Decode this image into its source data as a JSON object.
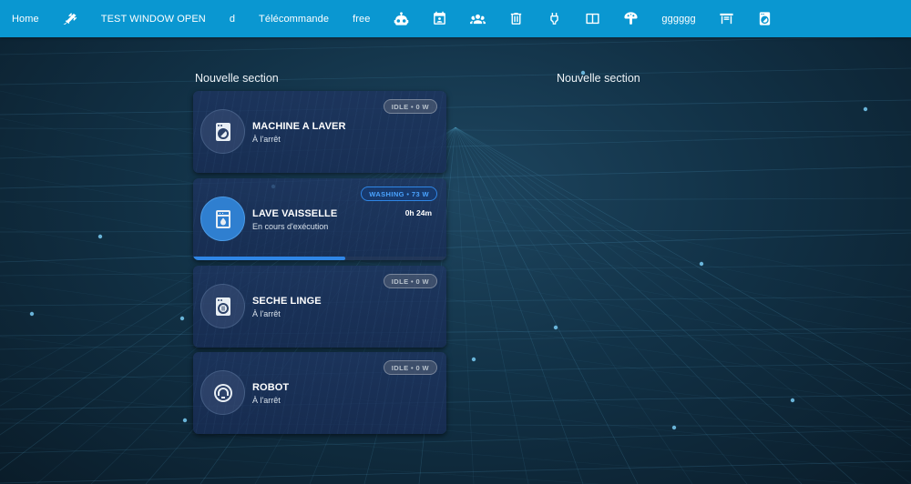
{
  "colors": {
    "topbar": "#0a97d1",
    "accent_active": "#2f86e6",
    "card_bg": "#1e3460",
    "badge_idle": "#b8c2cc"
  },
  "topbar": {
    "tabs": [
      {
        "type": "text",
        "label": "Home"
      },
      {
        "type": "icon",
        "icon": "robot-arm-icon"
      },
      {
        "type": "text",
        "label": "TEST WINDOW OPEN"
      },
      {
        "type": "text",
        "label": "d"
      },
      {
        "type": "text",
        "label": "Télécommande"
      },
      {
        "type": "text",
        "label": "free"
      },
      {
        "type": "icon",
        "icon": "robot-icon"
      },
      {
        "type": "icon",
        "icon": "calendar-account-icon"
      },
      {
        "type": "icon",
        "icon": "account-group-icon"
      },
      {
        "type": "icon",
        "icon": "trash-icon"
      },
      {
        "type": "icon",
        "icon": "plug-icon"
      },
      {
        "type": "icon",
        "icon": "book-open-icon"
      },
      {
        "type": "icon",
        "icon": "mushroom-icon"
      },
      {
        "type": "text",
        "label": "gggggg"
      },
      {
        "type": "icon",
        "icon": "gate-icon"
      },
      {
        "type": "icon",
        "icon": "washing-machine-icon"
      }
    ]
  },
  "sections": [
    {
      "title": "Nouvelle section"
    },
    {
      "title": "Nouvelle section"
    }
  ],
  "cards": [
    {
      "name": "MACHINE A LAVER",
      "state": "À l'arrêt",
      "badge": "IDLE • 0 W",
      "active": false,
      "icon": "washing-machine-icon"
    },
    {
      "name": "LAVE VAISSELLE",
      "state": "En cours d'exécution",
      "badge": "WASHING • 73 W",
      "active": true,
      "timer": "0h 24m",
      "progress": 0.6,
      "icon": "dishwasher-icon"
    },
    {
      "name": "SECHE LINGE",
      "state": "À l'arrêt",
      "badge": "IDLE • 0 W",
      "active": false,
      "icon": "tumble-dryer-icon"
    },
    {
      "name": "ROBOT",
      "state": "À l'arrêt",
      "badge": "IDLE • 0 W",
      "active": false,
      "icon": "robot-vacuum-icon"
    }
  ]
}
